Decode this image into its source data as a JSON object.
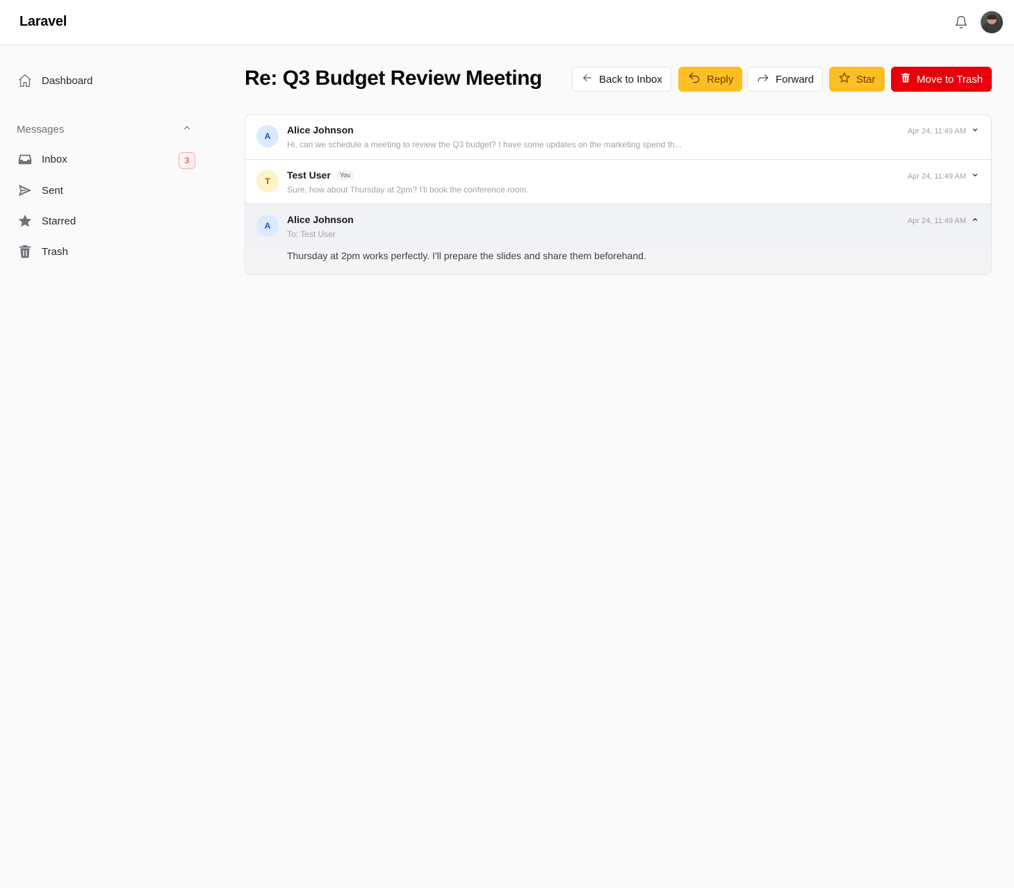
{
  "app": {
    "brand": "Laravel"
  },
  "topbar": {
    "notifications_icon": "bell-icon",
    "avatar": "user-avatar"
  },
  "sidebar": {
    "dashboard": {
      "label": "Dashboard",
      "icon": "home-icon"
    },
    "section": {
      "label": "Messages",
      "icon": "chevron-up-icon"
    },
    "items": [
      {
        "label": "Inbox",
        "icon": "inbox-icon",
        "badge": "3"
      },
      {
        "label": "Sent",
        "icon": "send-icon"
      },
      {
        "label": "Starred",
        "icon": "star-icon"
      },
      {
        "label": "Trash",
        "icon": "trash-icon"
      }
    ]
  },
  "header": {
    "title": "Re: Q3 Budget Review Meeting",
    "actions": {
      "back": "Back to Inbox",
      "reply": "Reply",
      "forward": "Forward",
      "star": "Star",
      "trash": "Move to Trash"
    }
  },
  "thread": {
    "messages": [
      {
        "initial": "A",
        "sender": "Alice Johnson",
        "snippet": "Hi, can we schedule a meeting to review the Q3 budget? I have some updates on the marketing spend th...",
        "time": "Apr 24, 11:49 AM",
        "expanded": false
      },
      {
        "initial": "T",
        "sender": "Test User",
        "badge": "You",
        "snippet": "Sure, how about Thursday at 2pm? I'll book the conference room.",
        "time": "Apr 24, 11:49 AM",
        "expanded": false
      },
      {
        "initial": "A",
        "sender": "Alice Johnson",
        "to": "To: Test User",
        "time": "Apr 24, 11:49 AM",
        "body": "Thursday at 2pm works perfectly. I'll prepare the slides and share them beforehand.",
        "expanded": true
      }
    ]
  },
  "colors": {
    "accent_amber": "#fbbf24",
    "danger": "#e7000b",
    "badge_red": "#dc2626"
  }
}
